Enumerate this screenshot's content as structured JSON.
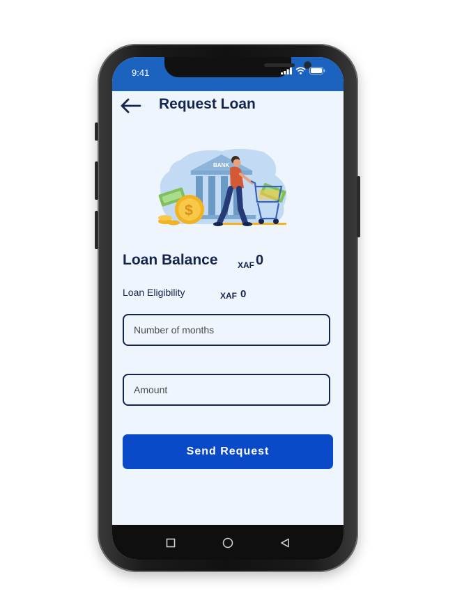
{
  "status_bar": {
    "time": "9:41"
  },
  "header": {
    "title": "Request Loan"
  },
  "loan_balance": {
    "label": "Loan Balance",
    "currency": "XAF",
    "value": "0"
  },
  "loan_eligibility": {
    "label": "Loan Eligibility",
    "currency": "XAF",
    "value": "0"
  },
  "form": {
    "months": {
      "value": "",
      "placeholder": "Number of months"
    },
    "amount": {
      "value": "",
      "placeholder": "Amount"
    },
    "submit_label": "Send Request"
  },
  "illustration": {
    "bank_sign": "BANK"
  },
  "colors": {
    "brand": "#1c63c0",
    "button": "#0a4ac9",
    "text": "#13244f",
    "background": "#eef5fd"
  },
  "icons": [
    "back-arrow-icon",
    "signal-icon",
    "wifi-icon",
    "battery-icon",
    "square-nav-icon",
    "circle-nav-icon",
    "triangle-nav-icon"
  ]
}
